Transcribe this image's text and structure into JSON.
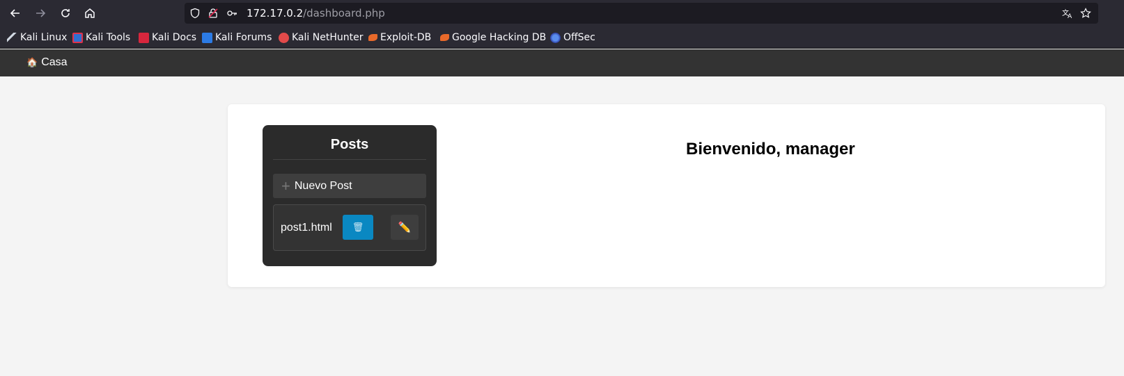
{
  "browser": {
    "url_host": "172.17.0.2",
    "url_path": "/dashboard.php",
    "bookmarks": [
      {
        "label": "Kali Linux",
        "icon": "kali-dragon-icon"
      },
      {
        "label": "Kali Tools",
        "icon": "kali-tools-icon"
      },
      {
        "label": "Kali Docs",
        "icon": "kali-docs-icon"
      },
      {
        "label": "Kali Forums",
        "icon": "kali-forums-icon"
      },
      {
        "label": "Kali NetHunter",
        "icon": "kali-nethunter-icon"
      },
      {
        "label": "Exploit-DB",
        "icon": "exploit-db-icon"
      },
      {
        "label": "Google Hacking DB",
        "icon": "ghdb-icon"
      },
      {
        "label": "OffSec",
        "icon": "offsec-icon"
      }
    ]
  },
  "topnav": {
    "home_label": "Casa",
    "home_icon": "🏠"
  },
  "sidebar": {
    "title": "Posts",
    "new_post_label": "Nuevo Post",
    "posts": [
      {
        "name": "post1.html",
        "delete_icon": "🗑",
        "edit_icon": "✏️"
      }
    ]
  },
  "main": {
    "welcome": "Bienvenido, manager"
  },
  "colors": {
    "delete_button": "#0a88c2",
    "navbar": "#333333",
    "sidebar": "#2b2b2b"
  }
}
